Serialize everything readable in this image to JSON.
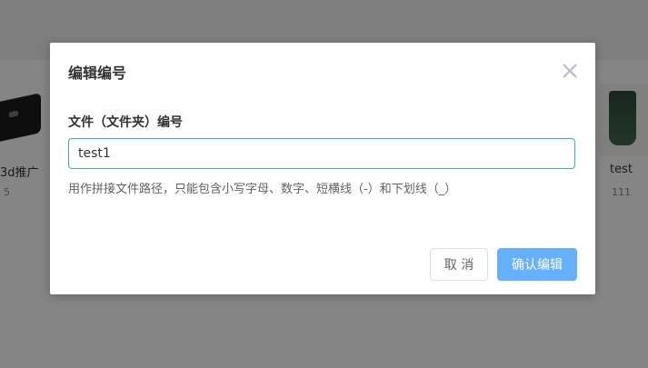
{
  "background": {
    "left_card": {
      "title": "3d推广",
      "count": "5"
    },
    "right_card": {
      "title": "test",
      "count": "111"
    }
  },
  "dialog": {
    "title": "编辑编号",
    "close_icon": "close-icon",
    "field_label": "文件（文件夹）编号",
    "input_value": "test1",
    "hint": "用作拼接文件路径，只能包含小写字母、数字、短横线（-）和下划线（_）",
    "cancel_label": "取 消",
    "confirm_label": "确认编辑"
  },
  "colors": {
    "accent": "#409eff",
    "confirm_button": "#66b1ff",
    "overlay": "#000000"
  }
}
